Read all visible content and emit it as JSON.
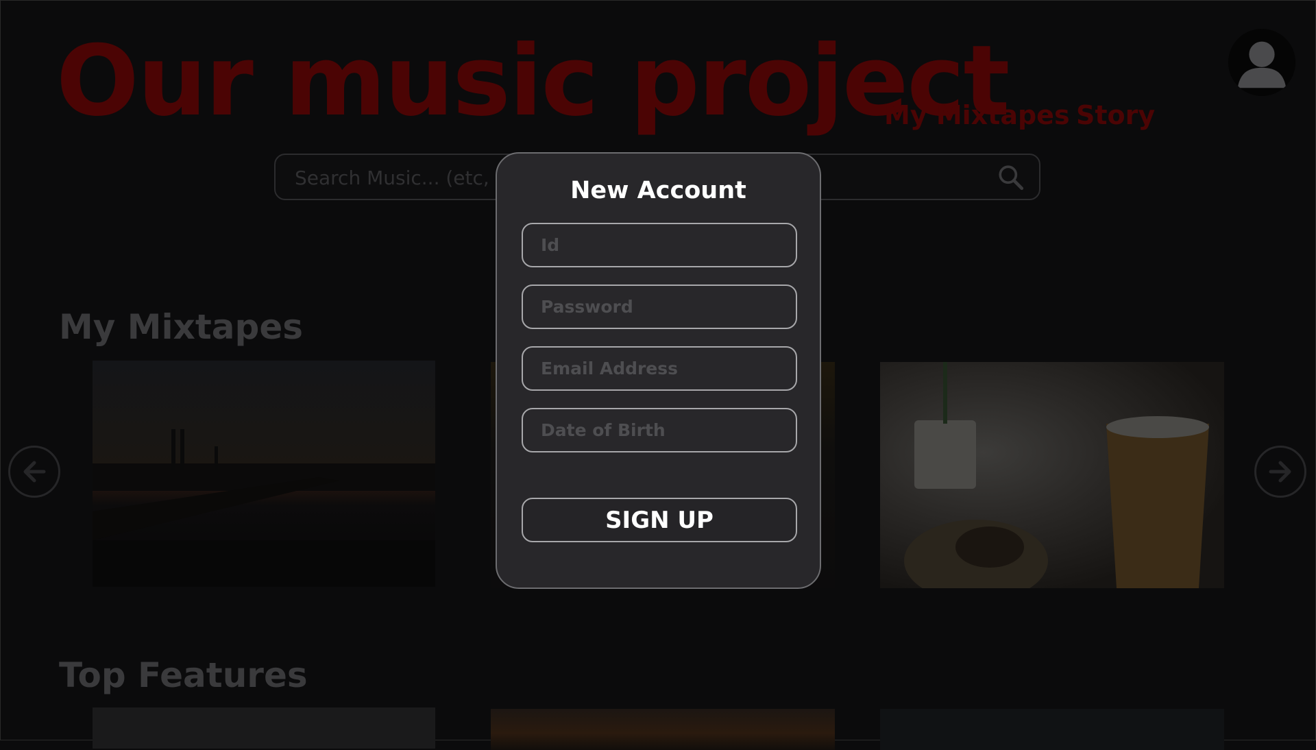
{
  "header": {
    "title": "Our music project",
    "nav": [
      "My Mixtapes",
      "Story"
    ]
  },
  "search": {
    "placeholder": "Search Music... (etc, na"
  },
  "sections": {
    "mixtapes_title": "My Mixtapes",
    "features_title": "Top Features"
  },
  "modal": {
    "title": "New Account",
    "fields": {
      "id_placeholder": "Id",
      "password_placeholder": "Password",
      "email_placeholder": "Email Address",
      "dob_placeholder": "Date of Birth"
    },
    "submit_label": "SIGN UP"
  },
  "colors": {
    "title_red": "#4b0404",
    "modal_bg": "#28272a",
    "modal_border": "#6d6d70",
    "field_border": "#a8a8ab"
  },
  "icons": {
    "avatar": "user-avatar-icon",
    "search": "search-icon",
    "carousel_prev": "arrow-left-circle-icon",
    "carousel_next": "arrow-right-circle-icon"
  }
}
